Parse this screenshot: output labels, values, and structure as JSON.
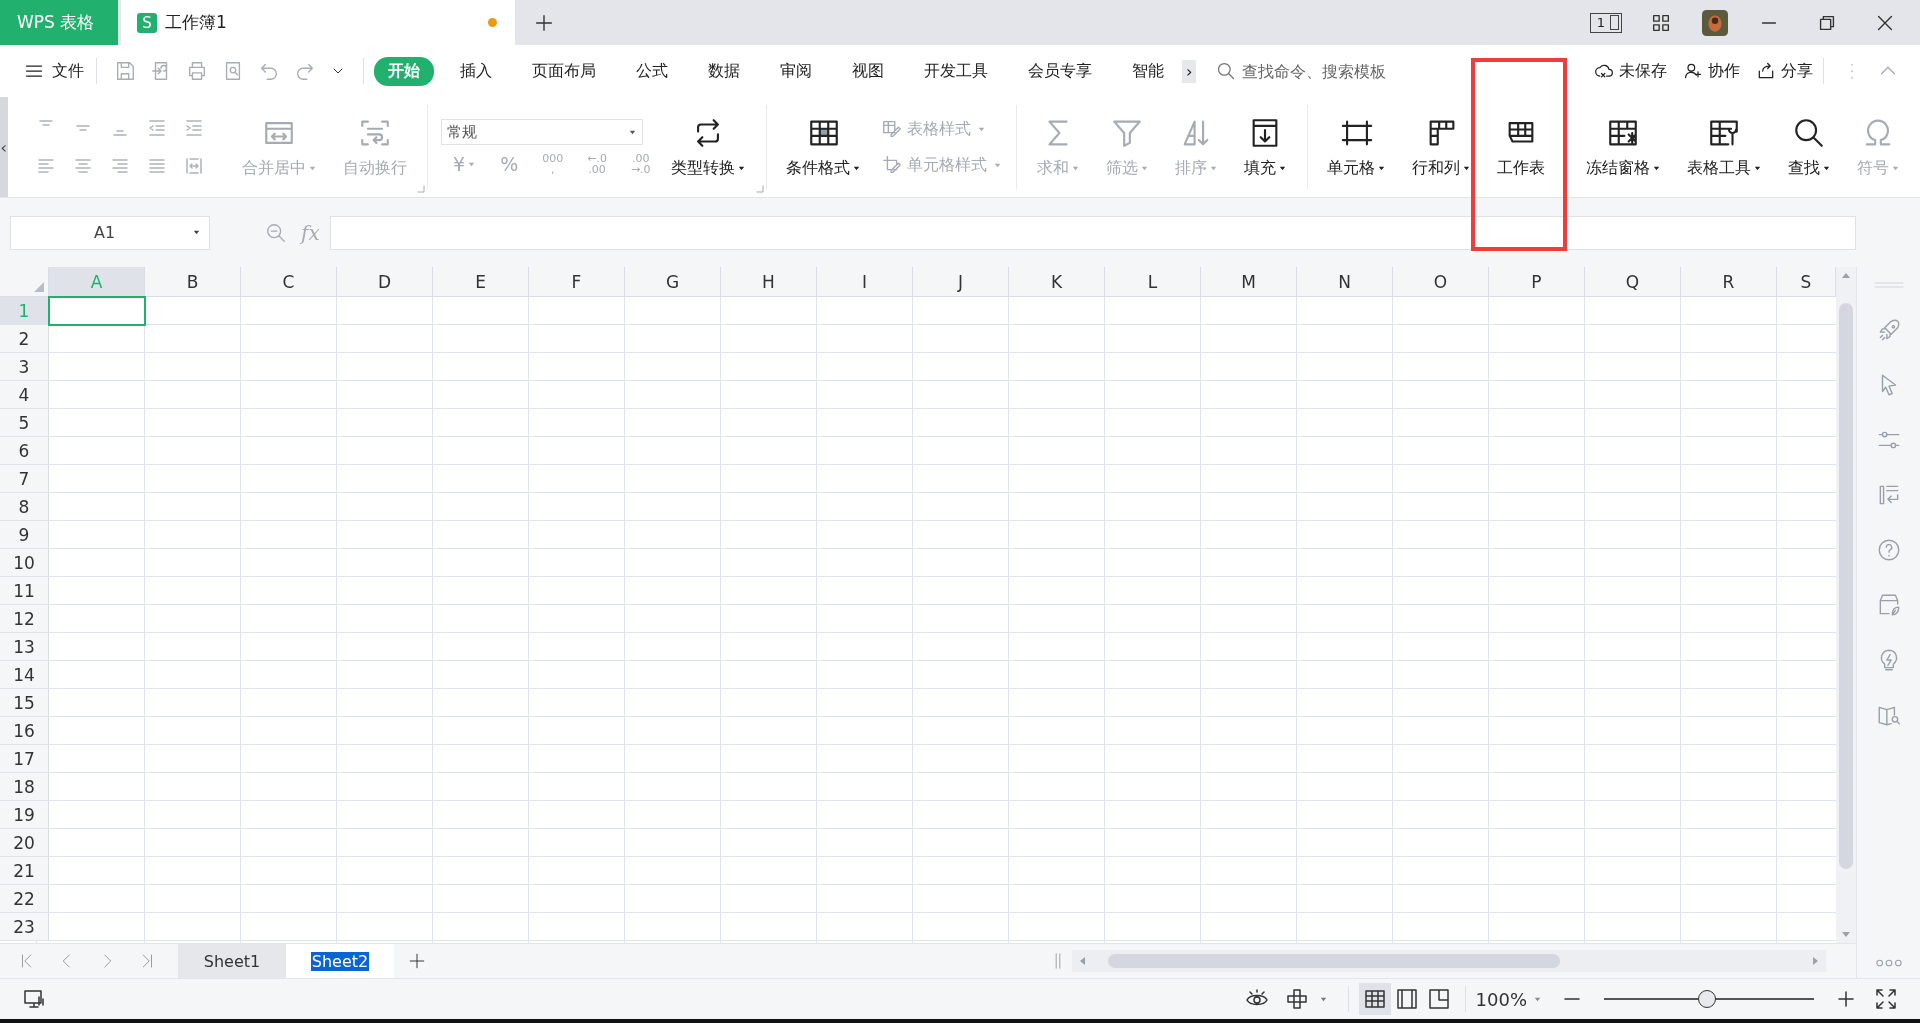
{
  "title_bar": {
    "app_tab": "WPS 表格",
    "document": {
      "logo": "S",
      "title": "工作簿1",
      "unsaved": true
    },
    "device_badge": "1"
  },
  "menu": {
    "file": "文件",
    "tabs": [
      {
        "label": "开始",
        "selected": true
      },
      {
        "label": "插入",
        "selected": false
      },
      {
        "label": "页面布局",
        "selected": false
      },
      {
        "label": "公式",
        "selected": false
      },
      {
        "label": "数据",
        "selected": false
      },
      {
        "label": "审阅",
        "selected": false
      },
      {
        "label": "视图",
        "selected": false
      },
      {
        "label": "开发工具",
        "selected": false
      },
      {
        "label": "会员专享",
        "selected": false
      },
      {
        "label": "智能",
        "selected": false
      }
    ],
    "more": "›",
    "search": {
      "placeholder": "查找命令、搜索模板"
    },
    "actions": [
      "未保存",
      "协作",
      "分享"
    ]
  },
  "ribbon": {
    "collapse": "‹",
    "groups": [
      {
        "kind": "align",
        "disabled": true,
        "launcher": true,
        "tools": [
          {
            "label": "合并居中",
            "disabled": true,
            "dropdown": true
          },
          {
            "label": "自动换行",
            "disabled": true,
            "dropdown": false
          }
        ]
      },
      {
        "kind": "number",
        "format": "常规",
        "launcher": true,
        "buttons": [
          {
            "lines": [
              "¥"
            ],
            "dropdown": true
          },
          {
            "lines": [
              "%"
            ],
            "dropdown": false
          },
          {
            "lines": [
              "000",
              ","
            ],
            "dropdown": false
          },
          {
            "lines": [
              "←.0",
              ".00"
            ],
            "dropdown": false
          },
          {
            "lines": [
              ".00",
              "→.0"
            ],
            "dropdown": false
          }
        ],
        "tools": [
          {
            "label": "类型转换",
            "disabled": false,
            "dropdown": true
          }
        ]
      },
      {
        "kind": "style",
        "tools": [
          {
            "label": "条件格式",
            "disabled": false,
            "dropdown": true
          }
        ],
        "small_tools": [
          {
            "label": "表格样式",
            "disabled": true,
            "dropdown": true
          },
          {
            "label": "单元格样式",
            "disabled": true,
            "dropdown": true
          }
        ]
      },
      {
        "kind": "large",
        "tools": [
          {
            "label": "求和",
            "disabled": true,
            "dropdown": true
          },
          {
            "label": "筛选",
            "disabled": true,
            "dropdown": true
          },
          {
            "label": "排序",
            "disabled": true,
            "dropdown": true
          },
          {
            "label": "填充",
            "disabled": false,
            "dropdown": true
          }
        ]
      },
      {
        "kind": "large",
        "tools": [
          {
            "label": "单元格",
            "disabled": false,
            "dropdown": true
          },
          {
            "label": "行和列",
            "disabled": false,
            "dropdown": true
          },
          {
            "label": "工作表",
            "disabled": false,
            "dropdown": false,
            "highlighted": true
          }
        ]
      },
      {
        "kind": "large",
        "tools": [
          {
            "label": "冻结窗格",
            "disabled": false,
            "dropdown": true
          },
          {
            "label": "表格工具",
            "disabled": false,
            "dropdown": true
          },
          {
            "label": "查找",
            "disabled": false,
            "dropdown": true
          },
          {
            "label": "符号",
            "disabled": true,
            "dropdown": true
          }
        ]
      }
    ]
  },
  "formula_bar": {
    "name_box": "A1",
    "fx": "fx"
  },
  "grid": {
    "columns": [
      {
        "label": "A",
        "selected": true
      },
      {
        "label": "B",
        "selected": false
      },
      {
        "label": "C",
        "selected": false
      },
      {
        "label": "D",
        "selected": false
      },
      {
        "label": "E",
        "selected": false
      },
      {
        "label": "F",
        "selected": false
      },
      {
        "label": "G",
        "selected": false
      },
      {
        "label": "H",
        "selected": false
      },
      {
        "label": "I",
        "selected": false
      },
      {
        "label": "J",
        "selected": false
      },
      {
        "label": "K",
        "selected": false
      },
      {
        "label": "L",
        "selected": false
      },
      {
        "label": "M",
        "selected": false
      },
      {
        "label": "N",
        "selected": false
      },
      {
        "label": "O",
        "selected": false
      },
      {
        "label": "P",
        "selected": false
      },
      {
        "label": "Q",
        "selected": false
      },
      {
        "label": "R",
        "selected": false
      },
      {
        "label": "S",
        "selected": false
      }
    ],
    "rows": [
      {
        "label": "1",
        "selected": true
      },
      {
        "label": "2",
        "selected": false
      },
      {
        "label": "3",
        "selected": false
      },
      {
        "label": "4",
        "selected": false
      },
      {
        "label": "5",
        "selected": false
      },
      {
        "label": "6",
        "selected": false
      },
      {
        "label": "7",
        "selected": false
      },
      {
        "label": "8",
        "selected": false
      },
      {
        "label": "9",
        "selected": false
      },
      {
        "label": "10",
        "selected": false
      },
      {
        "label": "11",
        "selected": false
      },
      {
        "label": "12",
        "selected": false
      },
      {
        "label": "13",
        "selected": false
      },
      {
        "label": "14",
        "selected": false
      },
      {
        "label": "15",
        "selected": false
      },
      {
        "label": "16",
        "selected": false
      },
      {
        "label": "17",
        "selected": false
      },
      {
        "label": "18",
        "selected": false
      },
      {
        "label": "19",
        "selected": false
      },
      {
        "label": "20",
        "selected": false
      },
      {
        "label": "21",
        "selected": false
      },
      {
        "label": "22",
        "selected": false
      },
      {
        "label": "23",
        "selected": false
      }
    ]
  },
  "sheet_tabs": [
    {
      "label": "Sheet1",
      "selected": false
    },
    {
      "label": "Sheet2",
      "selected": true
    }
  ],
  "status_bar": {
    "view_modes": [
      {
        "selected": true
      },
      {
        "selected": false
      },
      {
        "selected": false
      }
    ],
    "zoom": "100%",
    "zoom_slider": {
      "level": 0.49
    }
  }
}
